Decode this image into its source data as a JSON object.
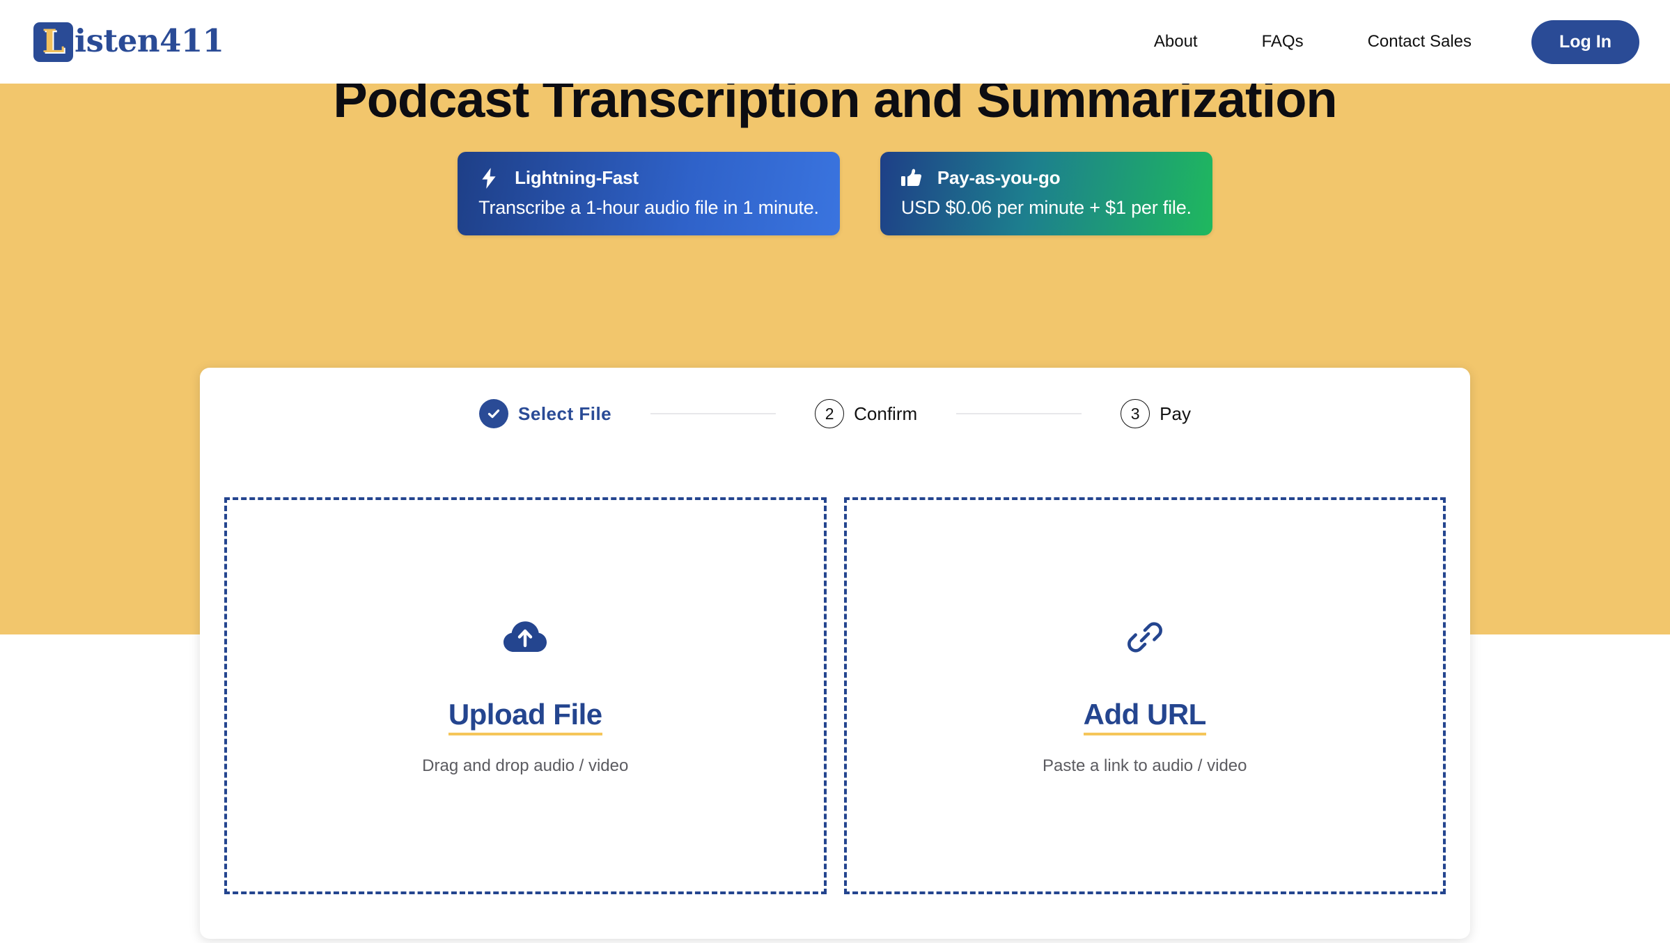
{
  "header": {
    "logo": {
      "badge_letter": "L",
      "word": "isten411",
      "full_name": "Listen411"
    },
    "nav": [
      {
        "label": "About",
        "name": "nav-link-about"
      },
      {
        "label": "FAQs",
        "name": "nav-link-faqs"
      },
      {
        "label": "Contact Sales",
        "name": "nav-link-contact-sales"
      }
    ],
    "login_label": "Log In"
  },
  "hero": {
    "title": "Podcast Transcription and Summarization",
    "background_color": "#f2c66c",
    "badges": [
      {
        "icon": "lightning-bolt-icon",
        "title": "Lightning-Fast",
        "subtitle": "Transcribe a 1-hour audio file in 1 minute.",
        "gradient_from": "#1e3f87",
        "gradient_to": "#3a74df"
      },
      {
        "icon": "thumbs-up-icon",
        "title": "Pay-as-you-go",
        "subtitle": "USD $0.06 per minute + $1 per file.",
        "gradient_from": "#1e3f87",
        "gradient_to": "#1fb85e"
      }
    ]
  },
  "card": {
    "steps": [
      {
        "marker": "✓",
        "label": "Select  File",
        "state": "done"
      },
      {
        "marker": "2",
        "label": "Confirm",
        "state": "todo"
      },
      {
        "marker": "3",
        "label": "Pay",
        "state": "todo"
      }
    ],
    "dropzones": [
      {
        "icon": "cloud-upload-icon",
        "title": "Upload File",
        "subtitle": "Drag and drop audio / video"
      },
      {
        "icon": "link-icon",
        "title": "Add URL",
        "subtitle": "Paste a link to audio / video"
      }
    ],
    "accent_color": "#24458f",
    "underline_color": "#f5c65a"
  }
}
